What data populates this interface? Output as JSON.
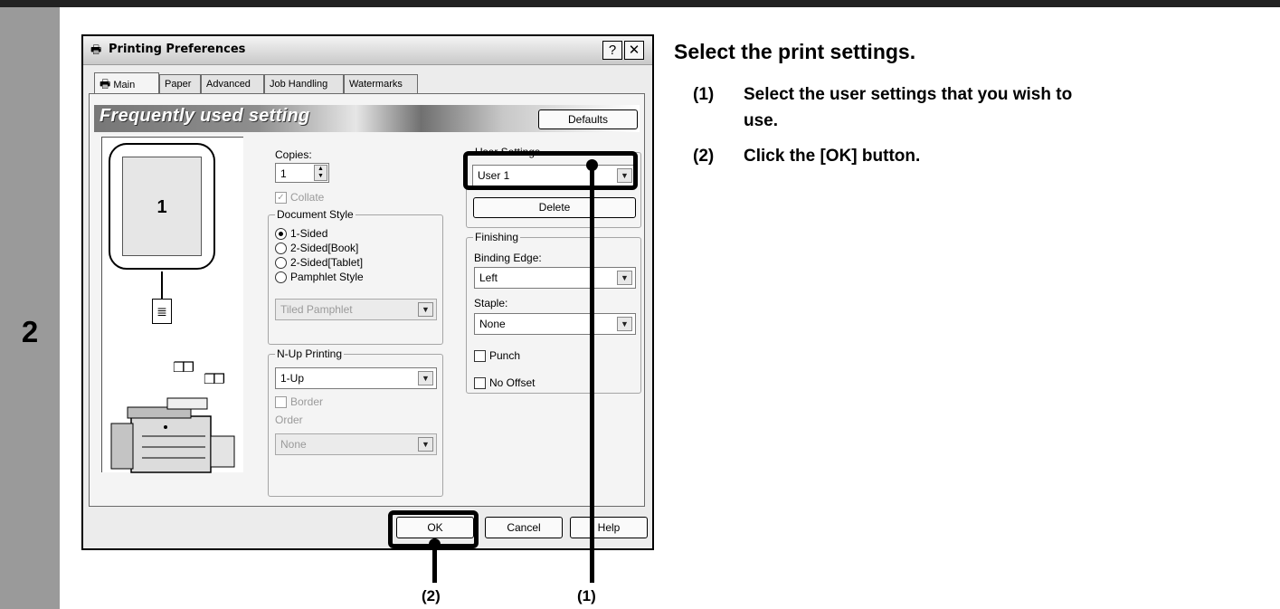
{
  "step_number": "2",
  "heading": "Select the print settings.",
  "instructions": [
    {
      "num": "(1)",
      "text": "Select the user settings that you wish to",
      "cont": "use."
    },
    {
      "num": "(2)",
      "text": "Click the [OK] button."
    }
  ],
  "callouts": {
    "ok": "(2)",
    "user_settings": "(1)"
  },
  "dialog": {
    "title": "Printing Preferences",
    "help_glyph": "?",
    "close_glyph": "✕",
    "tabs": [
      "Main",
      "Paper",
      "Advanced",
      "Job Handling",
      "Watermarks"
    ],
    "banner": "Frequently used setting",
    "defaults": "Defaults",
    "preview": {
      "page": "1"
    },
    "copies_label": "Copies:",
    "copies_value": "1",
    "collate": "Collate",
    "document_style": {
      "title": "Document Style",
      "options": [
        "1-Sided",
        "2-Sided[Book]",
        "2-Sided[Tablet]",
        "Pamphlet Style"
      ],
      "selected": "1-Sided",
      "pamphlet_select": "Tiled Pamphlet"
    },
    "nup": {
      "title": "N-Up Printing",
      "value": "1-Up",
      "border": "Border",
      "order_label": "Order",
      "order_value": "None"
    },
    "user_settings": {
      "title": "User Settings",
      "value": "User 1",
      "delete": "Delete"
    },
    "finishing": {
      "title": "Finishing",
      "binding_label": "Binding Edge:",
      "binding_value": "Left",
      "staple_label": "Staple:",
      "staple_value": "None",
      "punch": "Punch",
      "no_offset": "No Offset"
    },
    "buttons": {
      "ok": "OK",
      "cancel": "Cancel",
      "help": "Help"
    }
  },
  "colors": {
    "step_column": "#9a9a9a",
    "top_rule": "#222222"
  }
}
